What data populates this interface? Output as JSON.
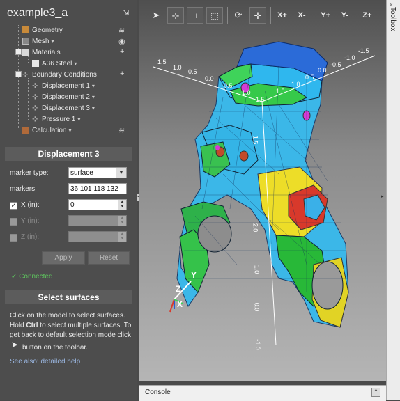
{
  "project": {
    "title": "example3_a"
  },
  "tree": {
    "items": [
      {
        "label": "Geometry",
        "right_icon": "view-icon"
      },
      {
        "label": "Mesh",
        "right_icon": "eye-icon"
      },
      {
        "label": "Materials",
        "right_icon": "plus-icon"
      },
      {
        "label": "A36 Steel"
      },
      {
        "label": "Boundary Conditions",
        "right_icon": "plus-icon"
      },
      {
        "label": "Displacement 1"
      },
      {
        "label": "Displacement 2"
      },
      {
        "label": "Displacement 3"
      },
      {
        "label": "Pressure 1"
      },
      {
        "label": "Calculation",
        "right_icon": "view-icon"
      }
    ]
  },
  "panel": {
    "title": "Displacement 3",
    "marker_type_label": "marker type:",
    "marker_type_value": "surface",
    "markers_label": "markers:",
    "markers_value": "36 101 118 132",
    "x_label": "X (in):",
    "x_value": "0",
    "y_label": "Y (in):",
    "z_label": "Z (in):",
    "apply_label": "Apply",
    "reset_label": "Reset"
  },
  "status": {
    "connected": "Connected"
  },
  "help": {
    "title": "Select surfaces",
    "line1": "Click on the model to select surfaces.",
    "line2_pre": "Hold ",
    "line2_key": "Ctrl",
    "line2_post": " to select multiple surfaces. To",
    "line3": "get back to default selection mode click",
    "line4": "button on the toolbar.",
    "link": "See also: detailed help"
  },
  "toolbar": {
    "xplus": "X+",
    "xminus": "X-",
    "yplus": "Y+",
    "yminus": "Y-",
    "zplus": "Z+"
  },
  "axes": {
    "x": "X",
    "y": "Y",
    "z": "Z",
    "ticks_left": [
      "1.5",
      "1.0",
      "0.5",
      "0.0",
      "-0.5",
      "-1.0",
      "-1.5"
    ],
    "ticks_right": [
      "1.5",
      "1.0",
      "0.5",
      "0.0",
      "-0.5",
      "-1.0",
      "-1.5"
    ],
    "ticks_vertical": [
      "2.0",
      "1.0",
      "0.0",
      "-1.0"
    ],
    "tick_small": "1.5"
  },
  "console": {
    "label": "Console"
  },
  "toolbox": {
    "label": "Toolbox"
  },
  "colors": {
    "accent_connected": "#5ec75e",
    "link": "#9ab6e0"
  }
}
